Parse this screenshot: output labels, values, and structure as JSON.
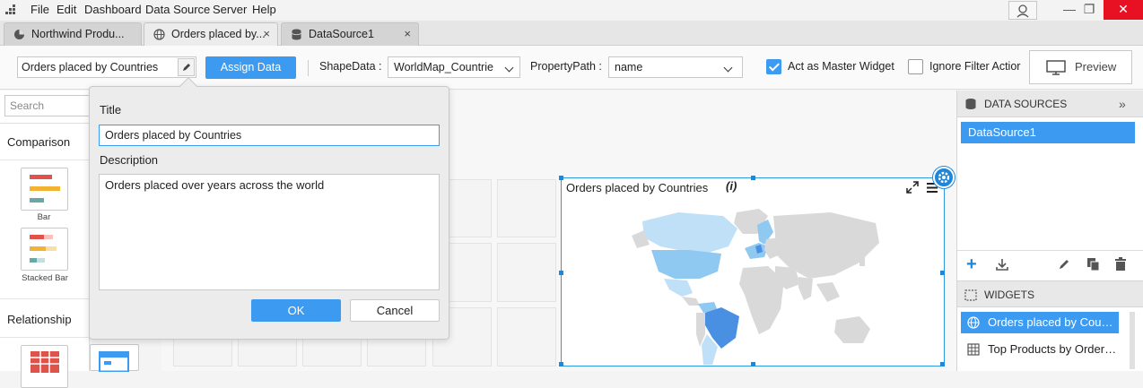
{
  "menu": {
    "items": [
      "File",
      "Edit",
      "Dashboard",
      "Data Source",
      "Server",
      "Help"
    ]
  },
  "window": {
    "minimize": "—",
    "restore": "❐",
    "close": "✕"
  },
  "tabs": [
    {
      "label": "Northwind Produ..."
    },
    {
      "label": "Orders placed by...",
      "close": "×"
    },
    {
      "label": "DataSource1",
      "close": "×"
    }
  ],
  "toolbar": {
    "widget_title": "Orders placed by Countries",
    "assign_data_label": "Assign Data",
    "shape_data_label": "ShapeData :",
    "shape_data_value": "WorldMap_Countrie",
    "property_path_label": "PropertyPath :",
    "property_path_value": "name",
    "master_widget_label": "Act as Master Widget",
    "master_widget_checked": true,
    "ignore_filter_label": "Ignore Filter Actior",
    "ignore_filter_checked": false,
    "preview_label": "Preview"
  },
  "left_panel": {
    "search_placeholder": "Search",
    "group_comparison": "Comparison",
    "item_bar": "Bar",
    "item_stacked_bar": "Stacked Bar",
    "group_relationship": "Relationship"
  },
  "dialog": {
    "title_label": "Title",
    "title_value": "Orders placed by Countries",
    "description_label": "Description",
    "description_value": "Orders placed over years across the world",
    "ok_label": "OK",
    "cancel_label": "Cancel"
  },
  "map_widget": {
    "title": "Orders placed by Countries",
    "info_icon": "i",
    "colors": {
      "base": "#d9d9d9",
      "light": "#bfe0f7",
      "medium": "#8fc8f0",
      "strong": "#4a90e2"
    }
  },
  "right_panel": {
    "data_sources_header": "DATA SOURCES",
    "data_source_item": "DataSource1",
    "widgets_header": "WIDGETS",
    "widget_items": [
      "Orders placed by Count...",
      "Top Products by Orders..."
    ]
  },
  "colors": {
    "accent": "#3c9bf0",
    "close_red": "#e81123"
  }
}
